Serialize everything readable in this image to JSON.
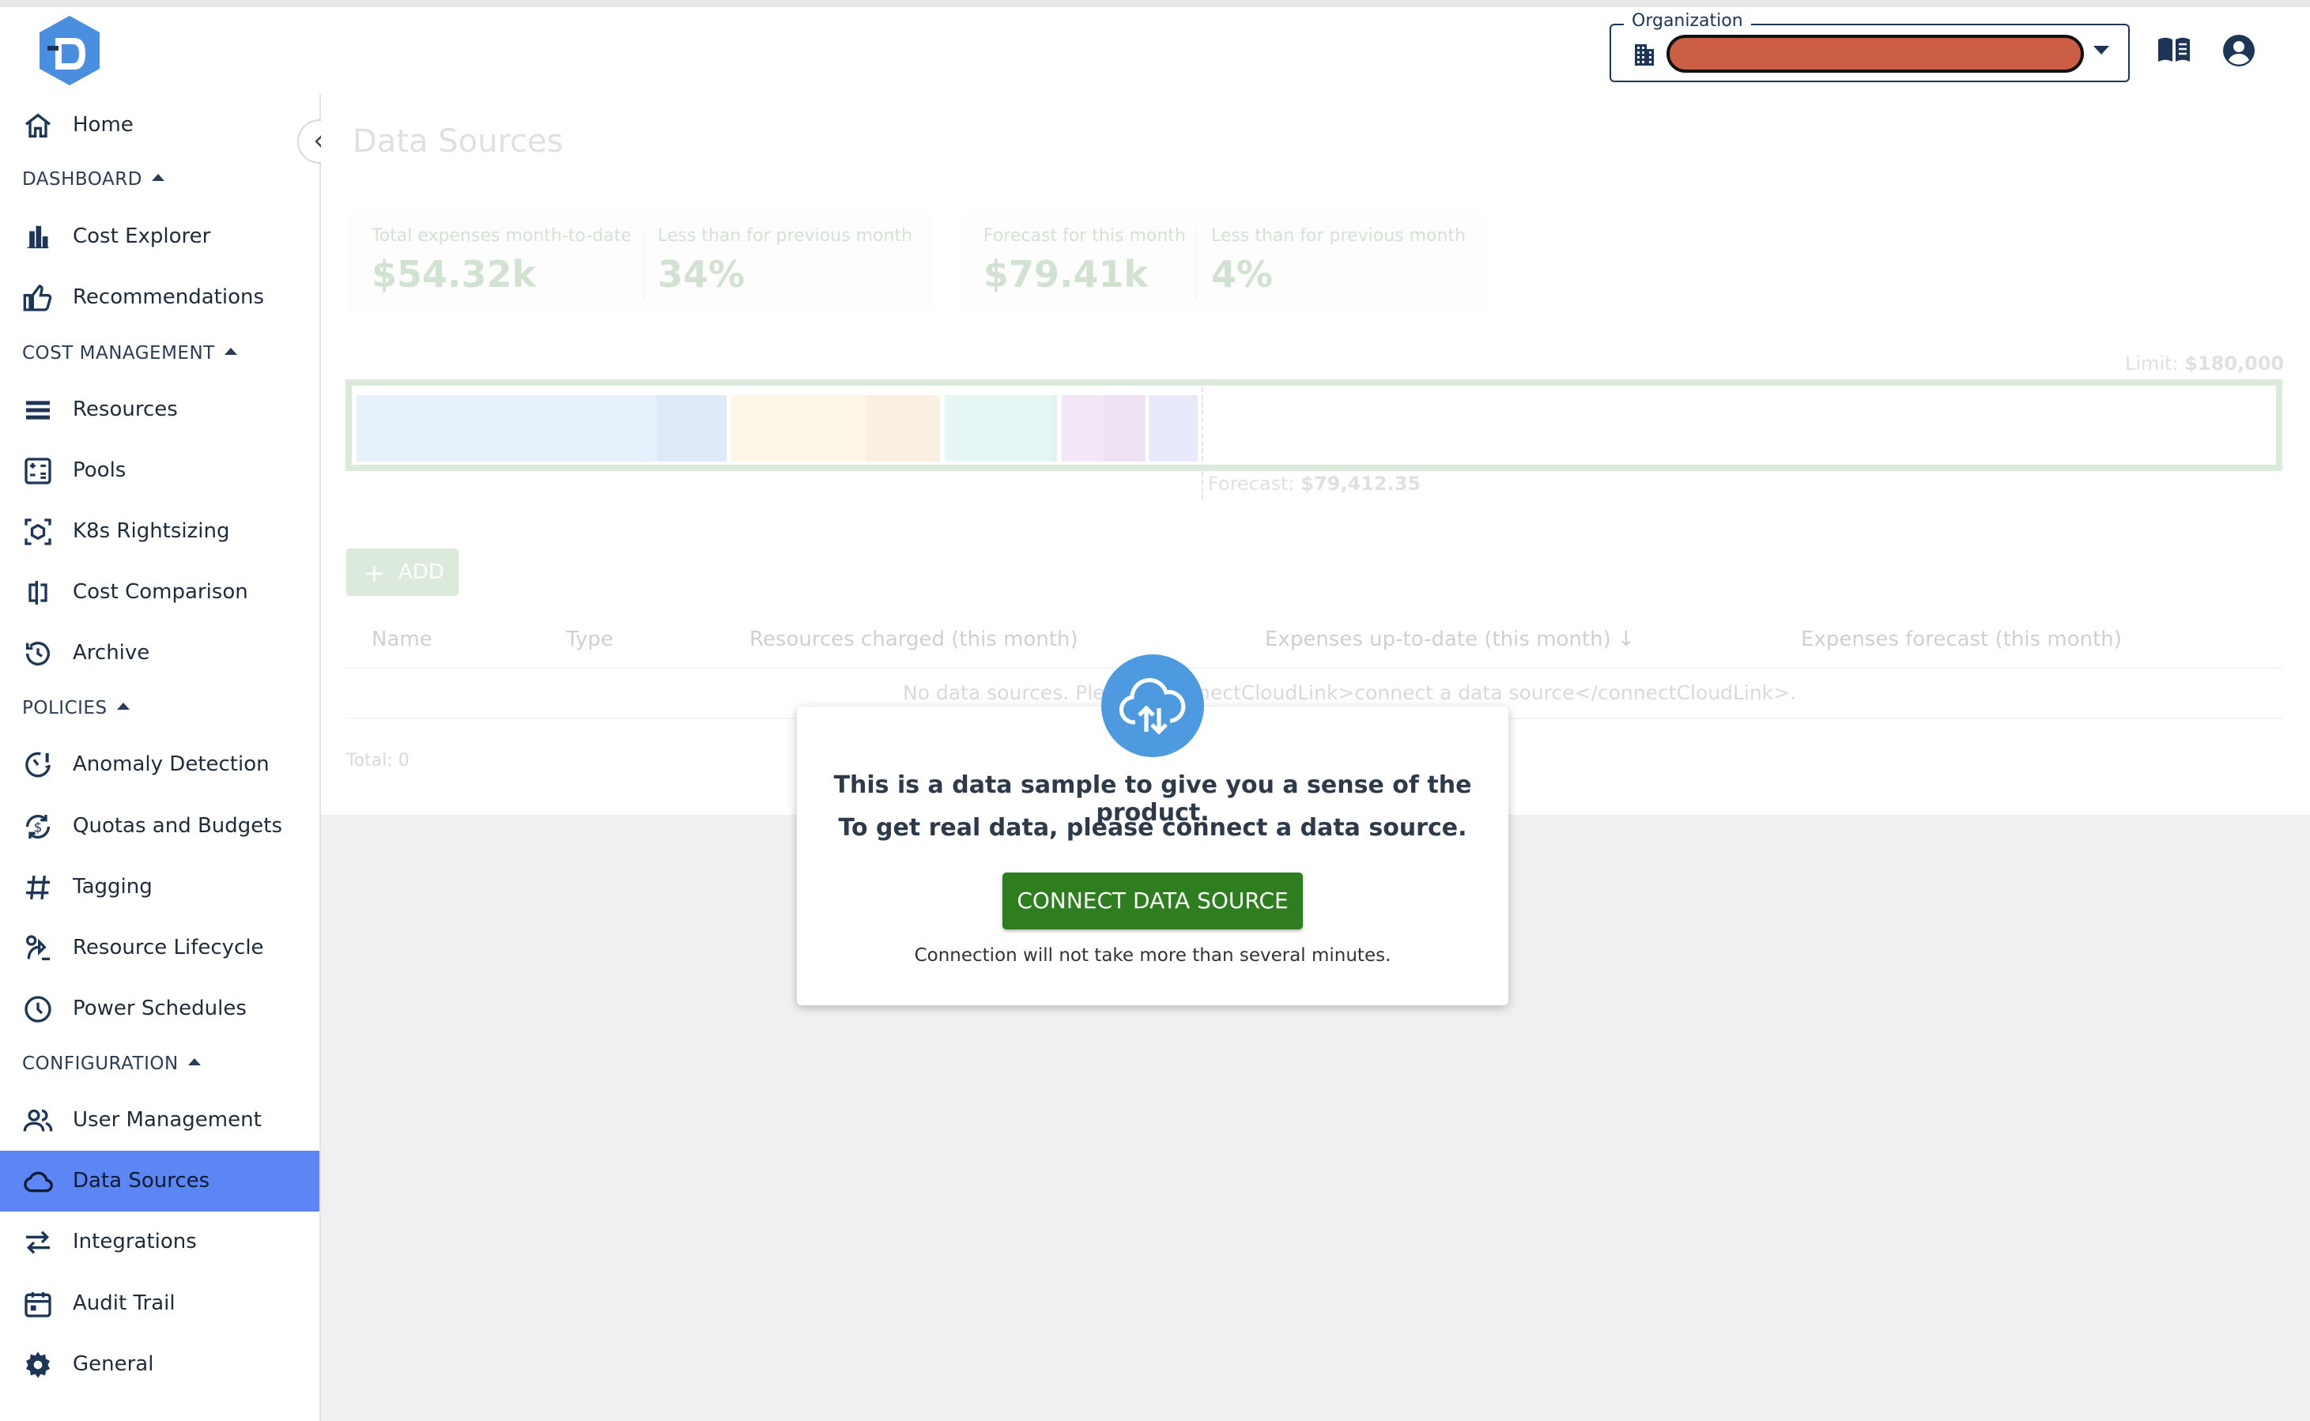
{
  "header": {
    "org_label": "Organization",
    "org_value_redacted": true
  },
  "sidebar": {
    "items": [
      {
        "label": "Home",
        "icon": "home-icon"
      },
      {
        "label": "Cost Explorer",
        "icon": "bar-chart-icon"
      },
      {
        "label": "Recommendations",
        "icon": "thumb-up-icon"
      },
      {
        "label": "Resources",
        "icon": "list-icon"
      },
      {
        "label": "Pools",
        "icon": "calculator-icon"
      },
      {
        "label": "K8s Rightsizing",
        "icon": "kubernetes-icon"
      },
      {
        "label": "Cost Comparison",
        "icon": "compare-icon"
      },
      {
        "label": "Archive",
        "icon": "history-icon"
      },
      {
        "label": "Anomaly Detection",
        "icon": "anomaly-icon"
      },
      {
        "label": "Quotas and Budgets",
        "icon": "budget-icon"
      },
      {
        "label": "Tagging",
        "icon": "hash-icon"
      },
      {
        "label": "Resource Lifecycle",
        "icon": "lifecycle-icon"
      },
      {
        "label": "Power Schedules",
        "icon": "clock-icon"
      },
      {
        "label": "User Management",
        "icon": "users-icon"
      },
      {
        "label": "Data Sources",
        "icon": "cloud-icon",
        "active": true
      },
      {
        "label": "Integrations",
        "icon": "swap-icon"
      },
      {
        "label": "Audit Trail",
        "icon": "calendar-icon"
      },
      {
        "label": "General",
        "icon": "gear-icon"
      }
    ],
    "sections": {
      "dashboard": "DASHBOARD",
      "cost_management": "COST MANAGEMENT",
      "policies": "POLICIES",
      "configuration": "CONFIGURATION"
    }
  },
  "main": {
    "title": "Data Sources",
    "summary": {
      "total_label": "Total expenses month-to-date",
      "total_value": "$54.32k",
      "total_cmp_label": "Less than for previous month",
      "total_cmp_value": "34%",
      "forecast_label": "Forecast for this month",
      "forecast_value": "$79.41k",
      "forecast_cmp_label": "Less than for previous month",
      "forecast_cmp_value": "4%"
    },
    "limit_prefix": "Limit: ",
    "limit_value": "$180,000",
    "forecast_prefix": "Forecast: ",
    "forecast_amount": "$79,412.35",
    "add_label": "ADD",
    "table": {
      "columns": [
        "Name",
        "Type",
        "Resources charged (this month)",
        "Expenses up-to-date (this month)",
        "Expenses forecast (this month)"
      ],
      "empty": "No data sources. Please <connectCloudLink>connect a data source</connectCloudLink>.",
      "total": "Total: 0"
    },
    "bar_colors": [
      "#8ec0f0",
      "#6aa0d8",
      "#f5d08a",
      "#eeb878",
      "#8fd6cc",
      "#78c8c0",
      "#c890d8",
      "#b07ccc",
      "#9c9cf0"
    ]
  },
  "dialog": {
    "line1": "This is a data sample to give you a sense of the product.",
    "line2": "To get real data, please connect a data source.",
    "button": "CONNECT DATA SOURCE",
    "note": "Connection will not take more than several minutes."
  }
}
